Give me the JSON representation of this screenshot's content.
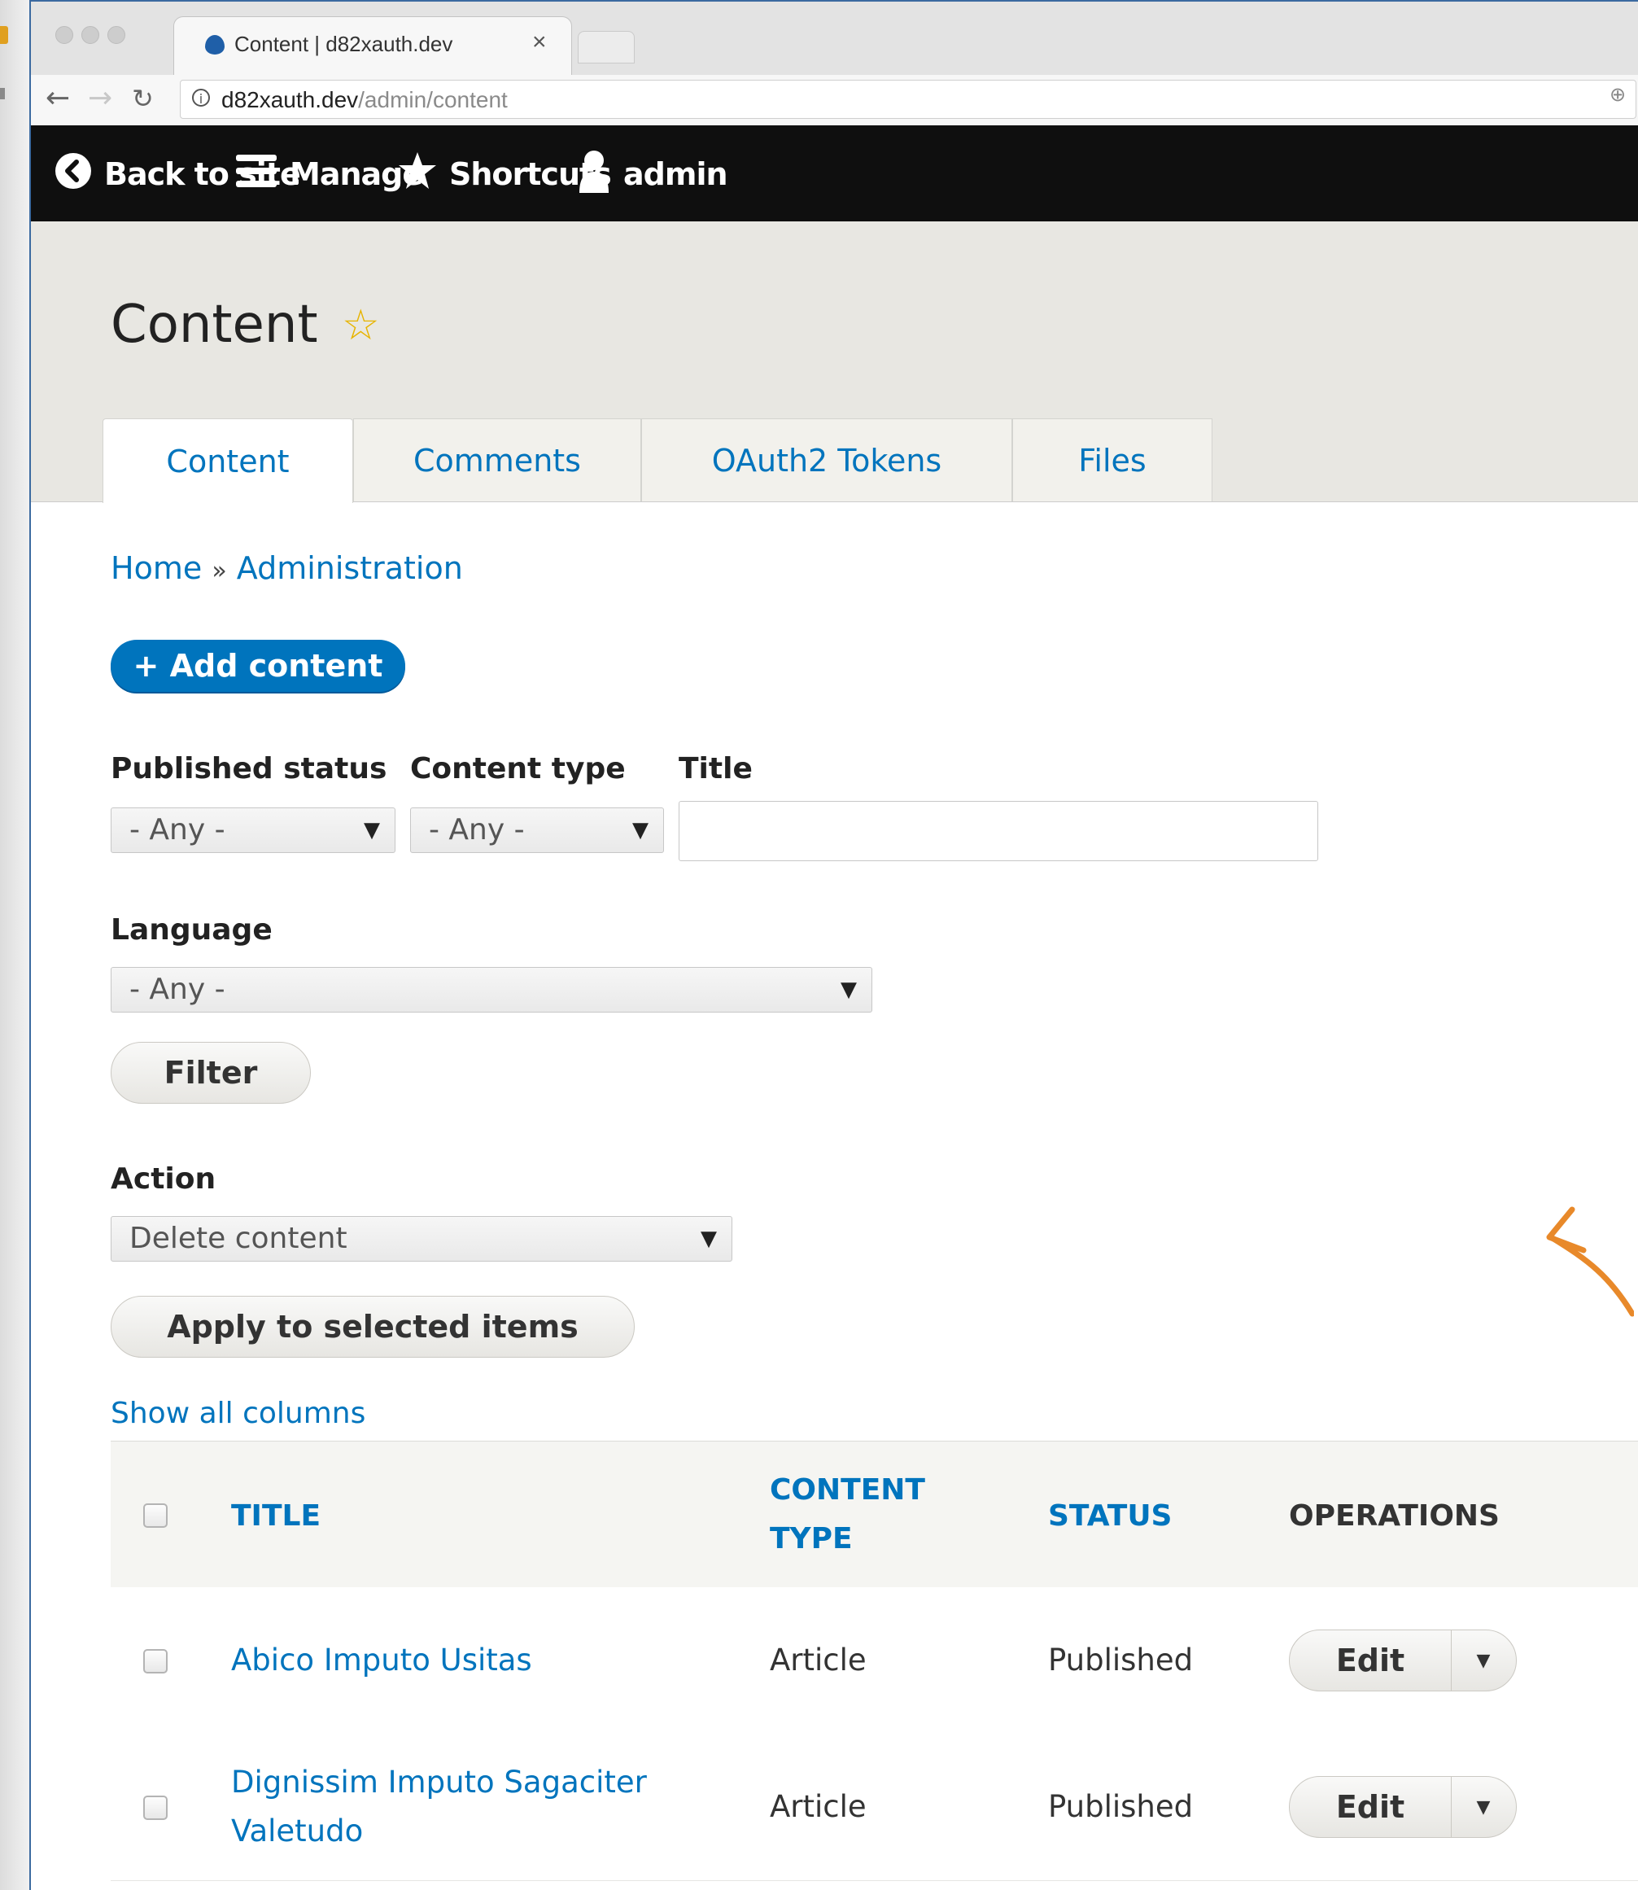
{
  "browser": {
    "tab_title": "Content | d82xauth.dev",
    "tab_close": "×",
    "url_host": "d82xauth.dev",
    "url_path": "/admin/content",
    "info_icon": "i"
  },
  "toolbar": {
    "back_to_site": "Back to site",
    "manage": "Manage",
    "shortcuts": "Shortcuts",
    "user": "admin"
  },
  "page": {
    "title": "Content",
    "tabs": [
      {
        "label": "Content",
        "active": true
      },
      {
        "label": "Comments",
        "active": false
      },
      {
        "label": "OAuth2 Tokens",
        "active": false
      },
      {
        "label": "Files",
        "active": false
      }
    ],
    "breadcrumb": {
      "home": "Home",
      "sep": "»",
      "admin": "Administration"
    },
    "add_content": "+ Add content"
  },
  "filters": {
    "published_status": {
      "label": "Published status",
      "value": "- Any -"
    },
    "content_type": {
      "label": "Content type",
      "value": "- Any -"
    },
    "title": {
      "label": "Title",
      "value": ""
    },
    "language": {
      "label": "Language",
      "value": "- Any -"
    },
    "filter_button": "Filter"
  },
  "action": {
    "label": "Action",
    "value": "Delete content",
    "apply_button": "Apply to selected items"
  },
  "show_all_columns": "Show all columns",
  "table": {
    "headers": {
      "title": "TITLE",
      "content_type_1": "CONTENT",
      "content_type_2": "TYPE",
      "status": "STATUS",
      "operations": "OPERATIONS"
    },
    "rows": [
      {
        "title": "Abico Imputo Usitas",
        "type": "Article",
        "status": "Published",
        "edit": "Edit"
      },
      {
        "title_1": "Dignissim Imputo Sagaciter",
        "title_2": "Valetudo",
        "type": "Article",
        "status": "Published",
        "edit": "Edit"
      }
    ]
  },
  "colors": {
    "link": "#0074bd",
    "toolbar": "#0f0f0f",
    "header_bg": "#e8e7e2",
    "arrow": "#e8892a"
  }
}
